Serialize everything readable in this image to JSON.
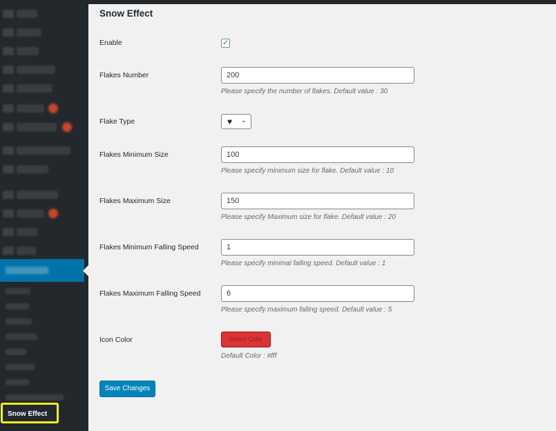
{
  "sidebar": {
    "highlighted_label": "Snow Effect"
  },
  "page": {
    "title": "Snow Effect"
  },
  "form": {
    "enable": {
      "label": "Enable",
      "checked": true,
      "check_glyph": "✓"
    },
    "flakes_number": {
      "label": "Flakes Number",
      "value": "200",
      "description": "Please specify the number of flakes. Default value : 30"
    },
    "flake_type": {
      "label": "Flake Type",
      "selected": "♥",
      "chevron": "⌄"
    },
    "flakes_min_size": {
      "label": "Flakes Minimum Size",
      "value": "100",
      "description": "Please specify minimum size for flake. Default value : 10"
    },
    "flakes_max_size": {
      "label": "Flakes Maximum Size",
      "value": "150",
      "description": "Please specify Maximum size for flake. Default value : 20"
    },
    "flakes_min_speed": {
      "label": "Flakes Minimum Falling Speed",
      "value": "1",
      "description": "Please specify minimal falling speed. Default value : 1"
    },
    "flakes_max_speed": {
      "label": "Flakes Maximum Falling Speed",
      "value": "6",
      "description": "Please specify maximum falling speed. Default value : 5"
    },
    "icon_color": {
      "label": "Icon Color",
      "button_label": "Select Color",
      "swatch_color": "#dd3333",
      "description": "Default Color : #fff"
    }
  },
  "actions": {
    "save_label": "Save Changes"
  },
  "colors": {
    "accent": "#0085ba",
    "sidebar_bg": "#23282d",
    "highlight": "#f7f21a"
  }
}
